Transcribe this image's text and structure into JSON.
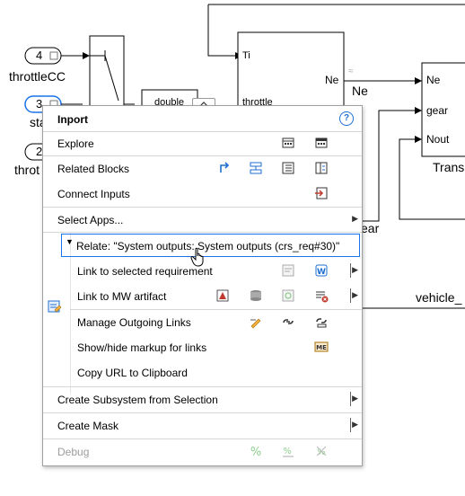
{
  "diagram": {
    "inports": [
      {
        "number": "4",
        "label": "throttleCC"
      },
      {
        "number": "3",
        "label": "sta"
      },
      {
        "number": "2",
        "label": "throt"
      }
    ],
    "convert_block_label": "double",
    "engine_block": {
      "ports_in": [
        "Ti",
        "throttle"
      ],
      "port_out": "Ne"
    },
    "signal_ne": "Ne",
    "transmission_block": {
      "ports_in": [
        "Ne",
        "gear",
        "Nout"
      ],
      "label": "Trans"
    },
    "signal_gear_partial": "ear",
    "signal_vehicle": "vehicle_"
  },
  "menu": {
    "title": "Inport",
    "help_label": "?",
    "items": {
      "explore": "Explore",
      "related_blocks": "Related Blocks",
      "connect_inputs": "Connect Inputs",
      "select_apps": "Select Apps...",
      "relate": "Relate: \"System outputs: System outputs (crs_req#30)\"",
      "link_selected_req": "Link to selected requirement",
      "link_mw_artifact": "Link to MW artifact",
      "manage_outgoing": "Manage Outgoing Links",
      "show_hide_markup": "Show/hide markup for links",
      "copy_url": "Copy URL to Clipboard",
      "create_subsystem": "Create Subsystem from Selection",
      "create_mask": "Create Mask",
      "debug": "Debug"
    },
    "icons": {
      "explore": [
        "block-grid-icon",
        "block-grid-dark-icon"
      ],
      "related_blocks": [
        "link-arrow-icon",
        "stacked-blocks-icon",
        "list-icon",
        "signal-table-icon"
      ],
      "connect_inputs": [
        "connect-inputs-icon"
      ],
      "link_selected_req": [
        "requirement-link-icon",
        "word-doc-icon"
      ],
      "link_mw_artifact": [
        "model-link-icon",
        "database-icon",
        "test-link-icon",
        "test-remove-icon"
      ],
      "manage_outgoing": [
        "manage-links-icon",
        "chain-icon",
        "chain-edit-icon"
      ],
      "show_hide_markup": [
        "markup-icon"
      ],
      "debug": [
        "percent-icon",
        "coverage-icon",
        "coverage-disabled-icon"
      ]
    },
    "colors": {
      "accent": "#1e6fd1",
      "highlight_border": "#1a73e8"
    }
  }
}
